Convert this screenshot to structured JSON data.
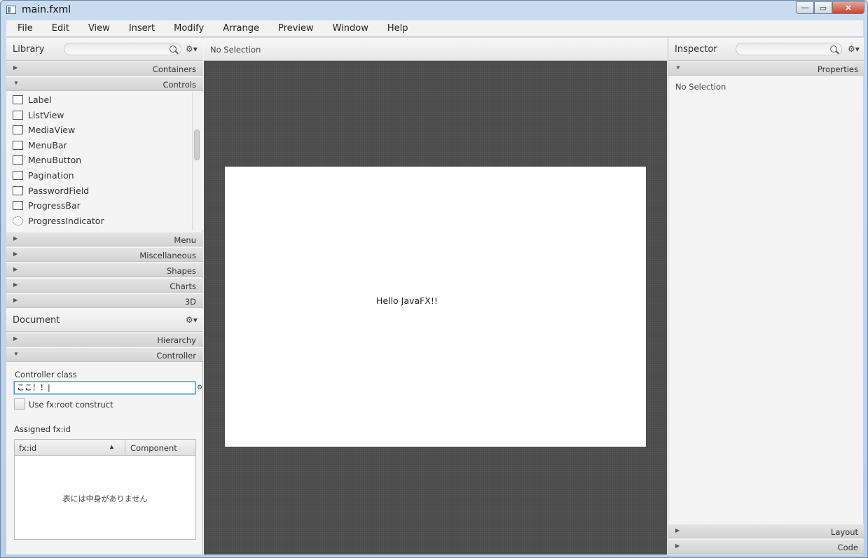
{
  "window": {
    "title": "main.fxml",
    "controls": {
      "minimize": "—",
      "maximize": "▭",
      "close": "✕"
    }
  },
  "menubar": {
    "items": [
      "File",
      "Edit",
      "View",
      "Insert",
      "Modify",
      "Arrange",
      "Preview",
      "Window",
      "Help"
    ]
  },
  "library": {
    "title": "Library",
    "search_placeholder": "",
    "sections": {
      "containers": "Containers",
      "controls": "Controls",
      "menu": "Menu",
      "misc": "Miscellaneous",
      "shapes": "Shapes",
      "charts": "Charts",
      "threed": "3D"
    },
    "controls_items": [
      "Label",
      "ListView",
      "MediaView",
      "MenuBar",
      "MenuButton",
      "Pagination",
      "PasswordField",
      "ProgressBar",
      "ProgressIndicator"
    ]
  },
  "document": {
    "title": "Document",
    "sections": {
      "hierarchy": "Hierarchy",
      "controller": "Controller"
    },
    "controller_class_label": "Controller class",
    "controller_class_value": "ここ！！|",
    "use_root_label": "Use fx:root construct",
    "assigned_label": "Assigned fx:id",
    "table": {
      "col_fxid": "fx:id",
      "col_component": "Component",
      "sort_indicator": "▲",
      "empty_message": "表には中身がありません"
    }
  },
  "center": {
    "selection_status": "No Selection",
    "canvas_text": "Hello JavaFX!!"
  },
  "inspector": {
    "title": "Inspector",
    "search_placeholder": "",
    "sections": {
      "properties": "Properties",
      "layout": "Layout",
      "code": "Code"
    },
    "no_selection": "No Selection"
  },
  "icons": {
    "gear": "⚙▾",
    "expanded": "▼",
    "collapsed": "▶"
  }
}
